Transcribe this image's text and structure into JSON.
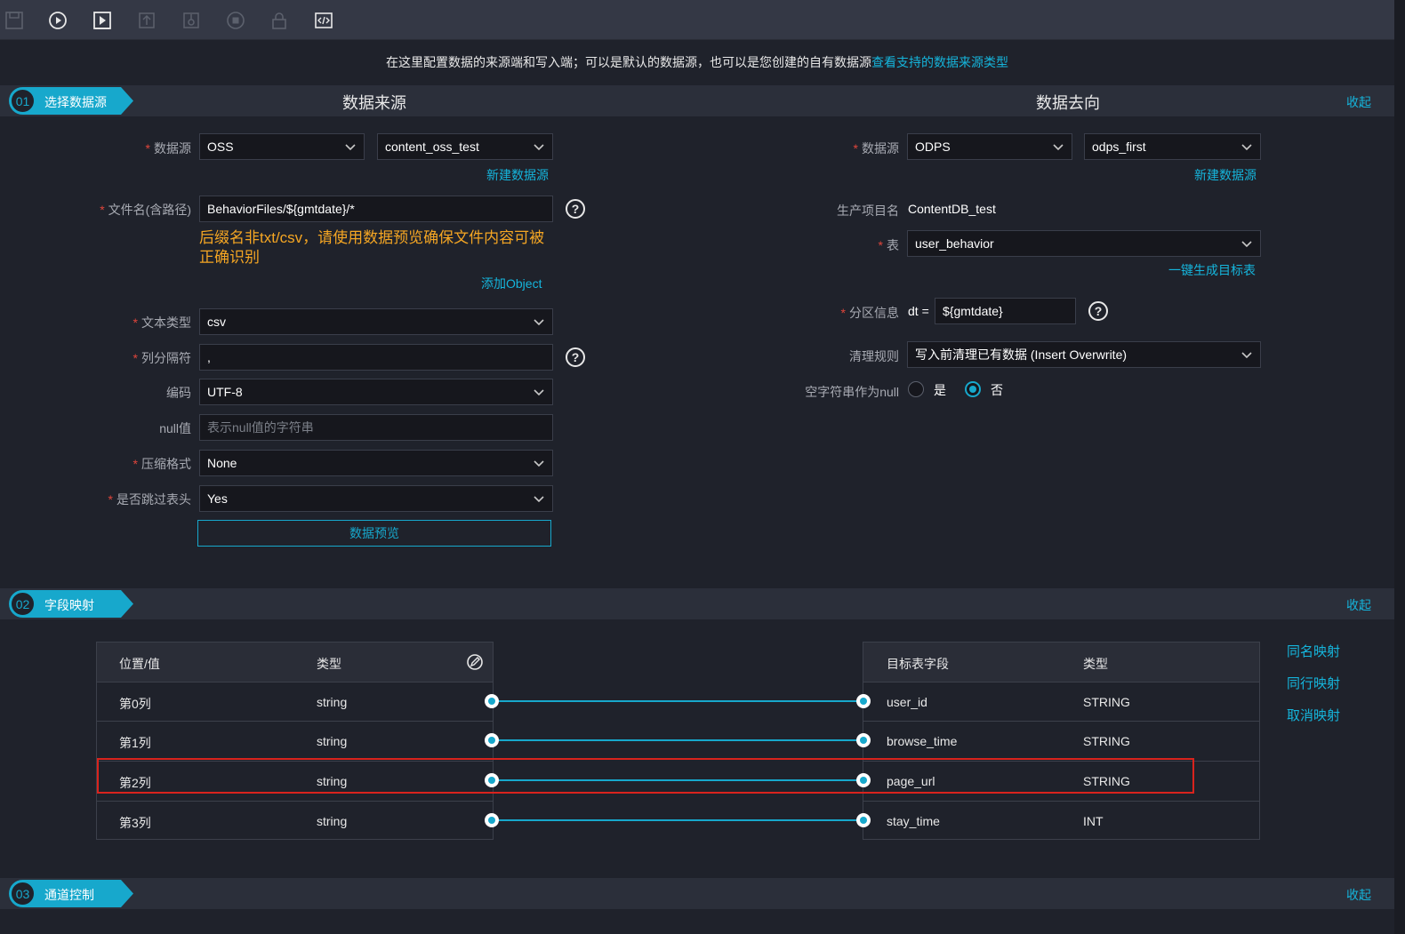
{
  "toolbar": {
    "icons": [
      "save-icon",
      "run-icon",
      "run-with-params-icon",
      "submit-icon",
      "publish-icon",
      "stop-icon",
      "lock-icon",
      "code-view-icon"
    ]
  },
  "hint": {
    "text": "在这里配置数据的来源端和写入端；可以是默认的数据源，也可以是您创建的自有数据源",
    "link": "查看支持的数据来源类型"
  },
  "section1": {
    "step": "01",
    "title": "选择数据源",
    "collapse": "收起",
    "source_heading": "数据来源",
    "target_heading": "数据去向"
  },
  "source": {
    "datasource_label": "数据源",
    "datasource_type": "OSS",
    "datasource_name": "content_oss_test",
    "new_datasource": "新建数据源",
    "filename_label": "文件名(含路径)",
    "filename_value": "BehaviorFiles/${gmtdate}/*",
    "warning": "后缀名非txt/csv，请使用数据预览确保文件内容可被正确识别",
    "add_object": "添加Object",
    "text_type_label": "文本类型",
    "text_type_value": "csv",
    "separator_label": "列分隔符",
    "separator_value": ",",
    "encoding_label": "编码",
    "encoding_value": "UTF-8",
    "null_label": "null值",
    "null_placeholder": "表示null值的字符串",
    "compress_label": "压缩格式",
    "compress_value": "None",
    "skip_header_label": "是否跳过表头",
    "skip_header_value": "Yes",
    "preview_button": "数据预览"
  },
  "target": {
    "datasource_label": "数据源",
    "datasource_type": "ODPS",
    "datasource_name": "odps_first",
    "new_datasource": "新建数据源",
    "project_label": "生产项目名",
    "project_value": "ContentDB_test",
    "table_label": "表",
    "table_value": "user_behavior",
    "gen_table_link": "一键生成目标表",
    "partition_label": "分区信息",
    "partition_prefix": "dt =",
    "partition_value": "${gmtdate}",
    "clean_label": "清理规则",
    "clean_value": "写入前清理已有数据 (Insert Overwrite)",
    "empty_null_label": "空字符串作为null",
    "yes": "是",
    "no": "否",
    "empty_null_selected": "否"
  },
  "section2": {
    "step": "02",
    "title": "字段映射",
    "collapse": "收起"
  },
  "mapping": {
    "source_headers": [
      "位置/值",
      "类型"
    ],
    "target_headers": [
      "目标表字段",
      "类型"
    ],
    "source_rows": [
      {
        "pos": "第0列",
        "type": "string"
      },
      {
        "pos": "第1列",
        "type": "string"
      },
      {
        "pos": "第2列",
        "type": "string"
      },
      {
        "pos": "第3列",
        "type": "string"
      }
    ],
    "target_rows": [
      {
        "field": "user_id",
        "type": "STRING"
      },
      {
        "field": "browse_time",
        "type": "STRING"
      },
      {
        "field": "page_url",
        "type": "STRING"
      },
      {
        "field": "stay_time",
        "type": "INT"
      }
    ],
    "highlighted_row": 2,
    "actions": [
      "同名映射",
      "同行映射",
      "取消映射"
    ]
  },
  "section3": {
    "step": "03",
    "title": "通道控制",
    "collapse": "收起"
  },
  "colors": {
    "accent": "#17a8cc",
    "link": "#15b5dc",
    "warning": "#f5a623",
    "required": "#e0453b",
    "highlight_box": "#d9231d"
  }
}
